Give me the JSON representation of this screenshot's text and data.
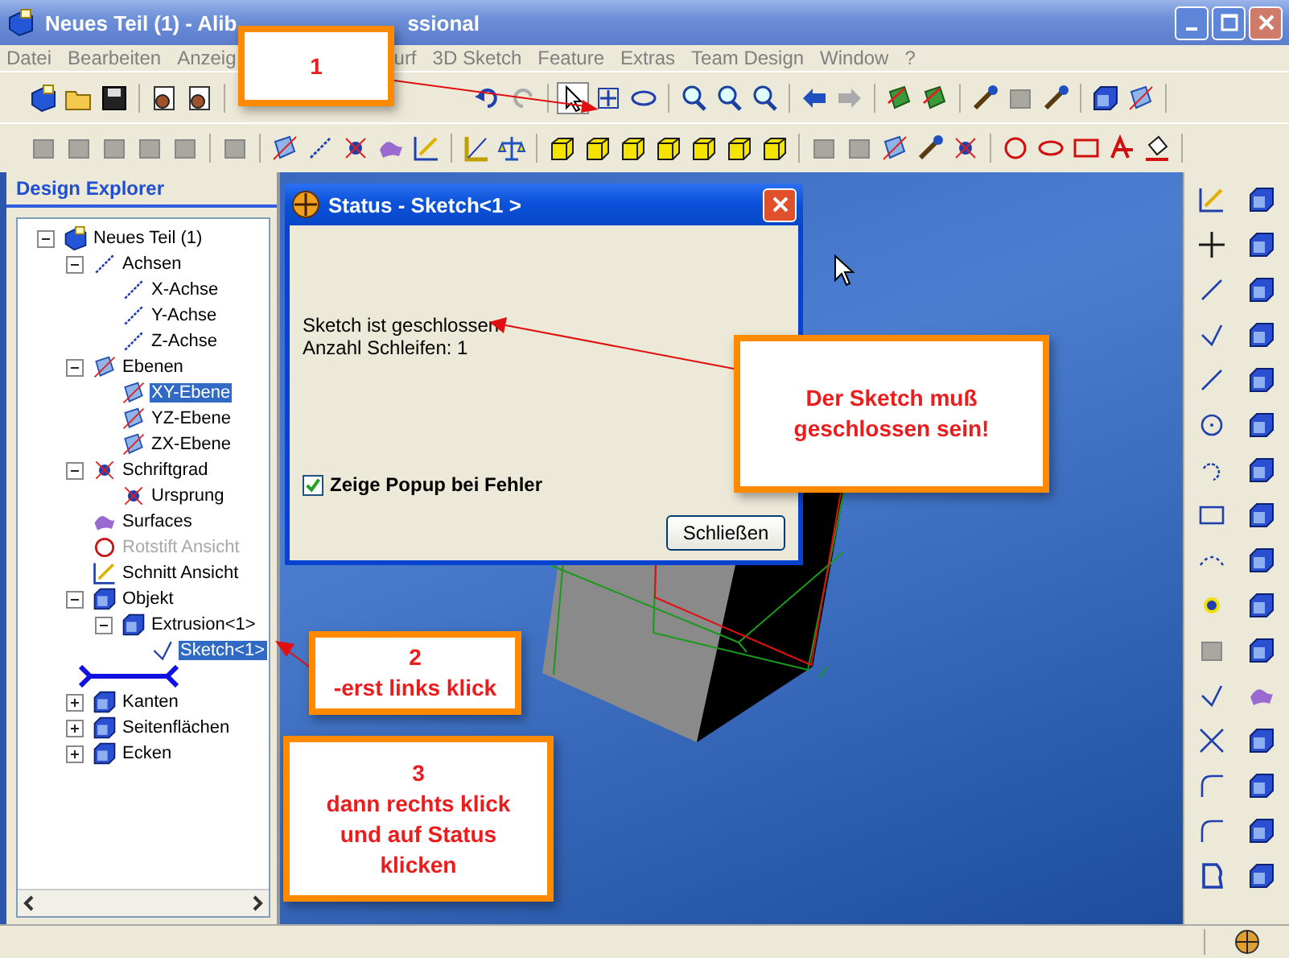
{
  "window": {
    "title": "Neues Teil (1) - Alib",
    "title_tail": "ssional"
  },
  "menu": [
    "Datei",
    "Bearbeiten",
    "Anzeig",
    "urf",
    "3D Sketch",
    "Feature",
    "Extras",
    "Team Design",
    "Window",
    "?"
  ],
  "explorer": {
    "title": "Design Explorer",
    "tree": [
      {
        "kind": "node",
        "label": "Neues Teil (1)",
        "expanded": true,
        "selected": false,
        "disabled": false,
        "children": [
          {
            "kind": "node",
            "label": "Achsen",
            "expanded": true,
            "selected": false,
            "disabled": false,
            "children": [
              {
                "kind": "node",
                "label": "X-Achse",
                "selected": false,
                "disabled": false
              },
              {
                "kind": "node",
                "label": "Y-Achse",
                "selected": false,
                "disabled": false
              },
              {
                "kind": "node",
                "label": "Z-Achse",
                "selected": false,
                "disabled": false
              }
            ]
          },
          {
            "kind": "node",
            "label": "Ebenen",
            "expanded": true,
            "selected": false,
            "disabled": false,
            "children": [
              {
                "kind": "node",
                "label": "XY-Ebene",
                "selected": true,
                "disabled": false
              },
              {
                "kind": "node",
                "label": "YZ-Ebene",
                "selected": false,
                "disabled": false
              },
              {
                "kind": "node",
                "label": "ZX-Ebene",
                "selected": false,
                "disabled": false
              }
            ]
          },
          {
            "kind": "node",
            "label": "Schriftgrad",
            "expanded": true,
            "selected": false,
            "disabled": false,
            "children": [
              {
                "kind": "node",
                "label": "Ursprung",
                "selected": false,
                "disabled": false
              }
            ]
          },
          {
            "kind": "node",
            "label": "Surfaces",
            "selected": false,
            "disabled": false
          },
          {
            "kind": "node",
            "label": "Rotstift Ansicht",
            "selected": false,
            "disabled": true
          },
          {
            "kind": "node",
            "label": "Schnitt Ansicht",
            "selected": false,
            "disabled": false
          },
          {
            "kind": "node",
            "label": "Objekt",
            "expanded": true,
            "selected": false,
            "disabled": false,
            "children": [
              {
                "kind": "node",
                "label": "Extrusion<1>",
                "expanded": true,
                "selected": false,
                "disabled": false,
                "children": [
                  {
                    "kind": "node",
                    "label": "Sketch<1>",
                    "selected": true,
                    "disabled": false
                  }
                ]
              }
            ]
          },
          {
            "kind": "drop-marker"
          },
          {
            "kind": "node",
            "label": "Kanten",
            "expanded": false,
            "selected": false,
            "disabled": false
          },
          {
            "kind": "node",
            "label": "Seitenflächen",
            "expanded": false,
            "selected": false,
            "disabled": false
          },
          {
            "kind": "node",
            "label": "Ecken",
            "expanded": false,
            "selected": false,
            "disabled": false
          }
        ]
      }
    ]
  },
  "dialog": {
    "title": "Status - Sketch<1 >",
    "lines": [
      "Sketch ist geschlossen",
      "Anzahl Schleifen: 1"
    ],
    "checkbox": {
      "label": "Zeige Popup bei Fehler",
      "checked": true
    },
    "button": "Schließen"
  },
  "callouts": [
    "1",
    "Der Sketch muß\ngeschlossen sein!",
    "2\n-erst links klick",
    "3\ndann rechts klick\nund auf Status\nklicken"
  ]
}
